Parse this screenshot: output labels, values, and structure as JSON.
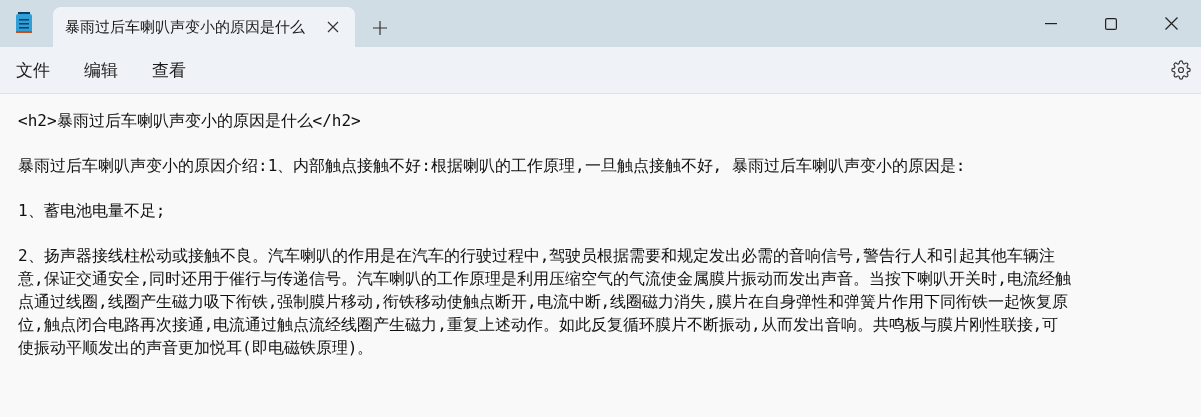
{
  "tab": {
    "title": "暴雨过后车喇叭声变小的原因是什么",
    "selected": true
  },
  "menu": [
    "文件",
    "编辑",
    "查看"
  ],
  "document": {
    "paragraphs": [
      {
        "lines": [
          "<h2>暴雨过后车喇叭声变小的原因是什么</h2>"
        ]
      },
      {
        "lines": [
          "暴雨过后车喇叭声变小的原因介绍:1、内部触点接触不好:根据喇叭的工作原理,一旦触点接触不好, 暴雨过后车喇叭声变小的原因是:"
        ]
      },
      {
        "lines": [
          "1、蓄电池电量不足;"
        ]
      },
      {
        "lines": [
          "2、扬声器接线柱松动或接触不良。汽车喇叭的作用是在汽车的行驶过程中,驾驶员根据需要和规定发出必需的音响信号,警告行人和引起其他车辆注",
          "意,保证交通安全,同时还用于催行与传递信号。汽车喇叭的工作原理是利用压缩空气的气流使金属膜片振动而发出声音。当按下喇叭开关时,电流经触",
          "点通过线圈,线圈产生磁力吸下衔铁,强制膜片移动,衔铁移动使触点断开,电流中断,线圈磁力消失,膜片在自身弹性和弹簧片作用下同衔铁一起恢复原",
          "位,触点闭合电路再次接通,电流通过触点流经线圈产生磁力,重复上述动作。如此反复循环膜片不断振动,从而发出音响。共鸣板与膜片刚性联接,可",
          "使振动平顺发出的声音更加悦耳(即电磁铁原理)。"
        ]
      }
    ]
  }
}
